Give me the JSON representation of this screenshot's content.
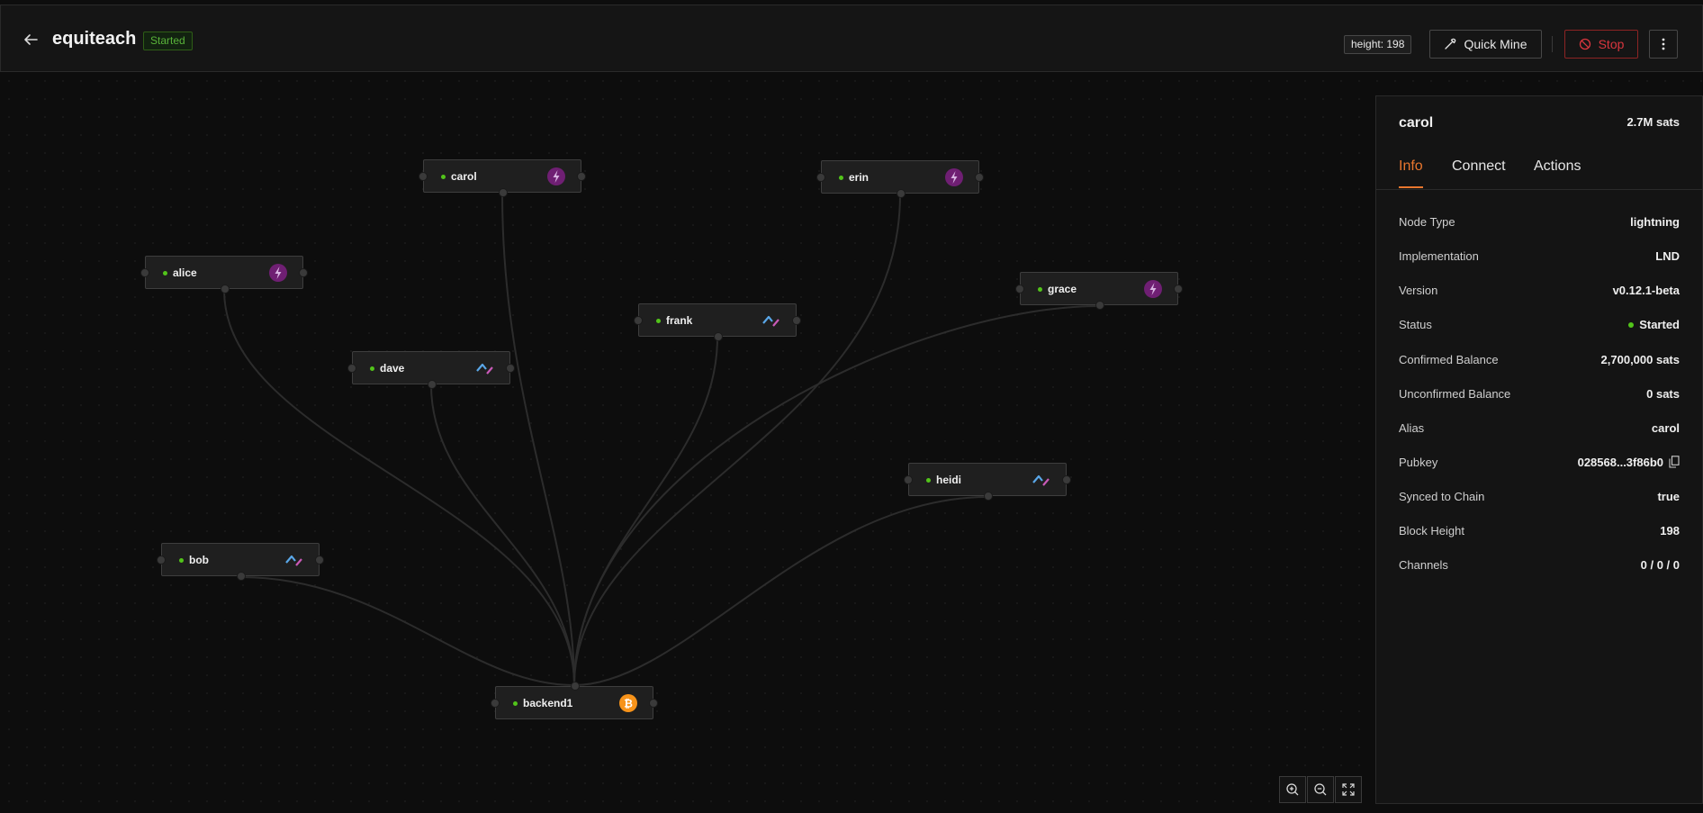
{
  "header": {
    "title": "equiteach",
    "status": "Started",
    "height_label": "height: 198",
    "quick_mine_label": "Quick Mine",
    "stop_label": "Stop"
  },
  "nodes": {
    "carol": {
      "name": "carol",
      "kind": "lnd"
    },
    "erin": {
      "name": "erin",
      "kind": "lnd"
    },
    "alice": {
      "name": "alice",
      "kind": "lnd"
    },
    "grace": {
      "name": "grace",
      "kind": "lnd"
    },
    "frank": {
      "name": "frank",
      "kind": "c-lightning"
    },
    "dave": {
      "name": "dave",
      "kind": "c-lightning"
    },
    "heidi": {
      "name": "heidi",
      "kind": "c-lightning"
    },
    "bob": {
      "name": "bob",
      "kind": "c-lightning"
    },
    "backend1": {
      "name": "backend1",
      "kind": "bitcoind"
    }
  },
  "colors": {
    "accent": "#e8762e",
    "started": "#52c41a",
    "lnd": "#6f1f73",
    "bitcoin": "#f7931a",
    "stop": "#d9363e"
  },
  "sidebar": {
    "title": "carol",
    "balance": "2.7M sats",
    "tabs": [
      "Info",
      "Connect",
      "Actions"
    ],
    "active_tab": "Info",
    "rows": [
      {
        "key": "Node Type",
        "value": "lightning"
      },
      {
        "key": "Implementation",
        "value": "LND"
      },
      {
        "key": "Version",
        "value": "v0.12.1-beta"
      },
      {
        "key": "Status",
        "value": "Started"
      },
      {
        "key": "Confirmed Balance",
        "value": "2,700,000 sats"
      },
      {
        "key": "Unconfirmed Balance",
        "value": "0 sats"
      },
      {
        "key": "Alias",
        "value": "carol"
      },
      {
        "key": "Pubkey",
        "value": "028568...3f86b0"
      },
      {
        "key": "Synced to Chain",
        "value": "true"
      },
      {
        "key": "Block Height",
        "value": "198"
      },
      {
        "key": "Channels",
        "value": "0 / 0 / 0"
      }
    ]
  },
  "icons": {
    "back": "arrow-left-icon",
    "quick_mine": "tool-icon",
    "stop": "stop-icon",
    "more": "more-vertical-icon",
    "zoom_in": "zoom-in-icon",
    "zoom_out": "zoom-out-icon",
    "fit": "fullscreen-icon",
    "copy": "copy-icon"
  }
}
